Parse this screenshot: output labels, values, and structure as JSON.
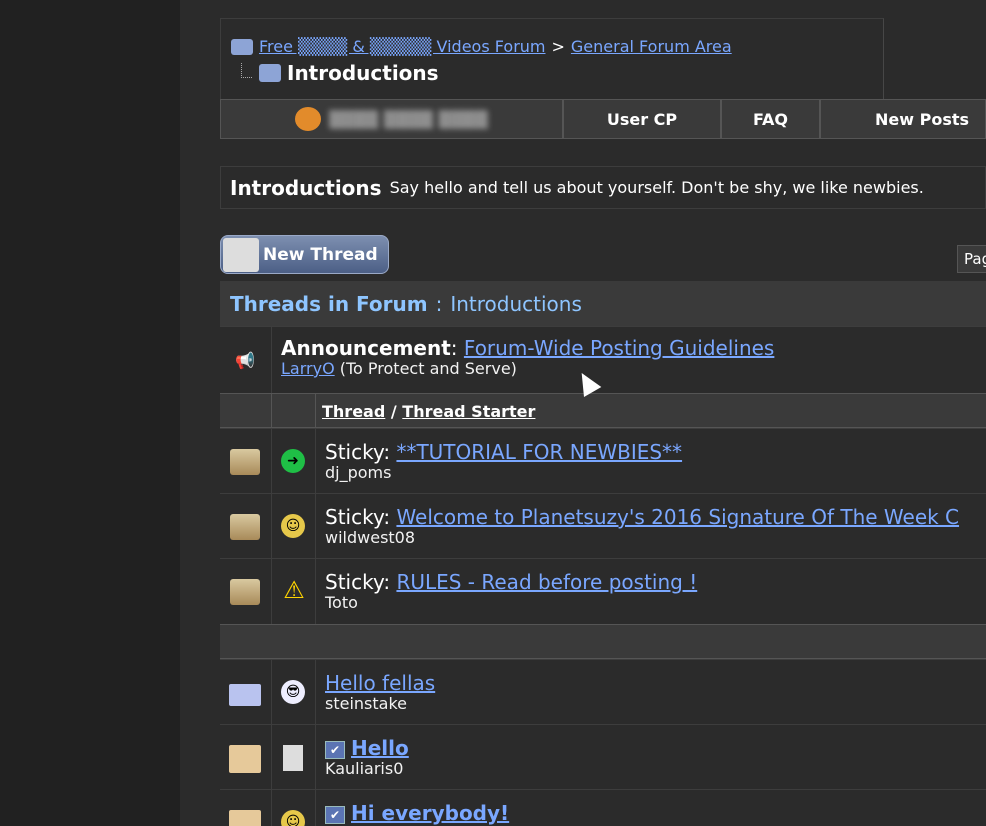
{
  "breadcrumb": {
    "forum_link": "Free ▒▒▒▒ & ▒▒▒▒▒ Videos Forum",
    "separator": ">",
    "section_link": "General Forum Area",
    "current": "Introductions"
  },
  "tabs": {
    "user_label": "▒▒▒▒ ▒▒▒▒ ▒▒▒▒",
    "user_cp": "User CP",
    "faq": "FAQ",
    "new_posts": "New Posts"
  },
  "forum": {
    "title": "Introductions",
    "description": "Say hello and tell us about yourself. Don't be shy, we like newbies."
  },
  "new_thread_label": "New Thread",
  "page_label": "Pag",
  "threads_header": {
    "prefix": "Threads in Forum",
    "separator": ":",
    "name": "Introductions"
  },
  "announcement": {
    "label": "Announcement",
    "title": "Forum-Wide Posting Guidelines",
    "author": "LarryO",
    "author_title": "(To Protect and Serve)"
  },
  "columns": {
    "thread": "Thread",
    "slash": "/",
    "starter": "Thread Starter"
  },
  "threads": [
    {
      "prefix": "Sticky:",
      "title": "**TUTORIAL FOR NEWBIES**",
      "starter": "dj_poms",
      "status_icon": "lock-folder-icon",
      "post_icon": "arrow-right-icon"
    },
    {
      "prefix": "Sticky:",
      "title": "Welcome to Planetsuzy's 2016 Signature Of The Week C",
      "starter": "wildwest08",
      "status_icon": "lock-folder-icon",
      "post_icon": "smiley-icon"
    },
    {
      "prefix": "Sticky:",
      "title": "RULES - Read before posting !",
      "starter": "Toto",
      "status_icon": "lock-folder-icon",
      "post_icon": "warning-icon"
    },
    {
      "prefix": "",
      "title": "Hello fellas",
      "starter": "steinstake",
      "status_icon": "envelope-icon",
      "post_icon": "cool-smiley-icon"
    },
    {
      "prefix": "",
      "title": "Hello",
      "starter": "Kauliaris0",
      "status_icon": "open-envelope-icon",
      "post_icon": "document-icon"
    },
    {
      "prefix": "",
      "title": "Hi everybody!",
      "starter": "",
      "status_icon": "open-envelope-icon",
      "post_icon": "smiley-icon"
    }
  ]
}
